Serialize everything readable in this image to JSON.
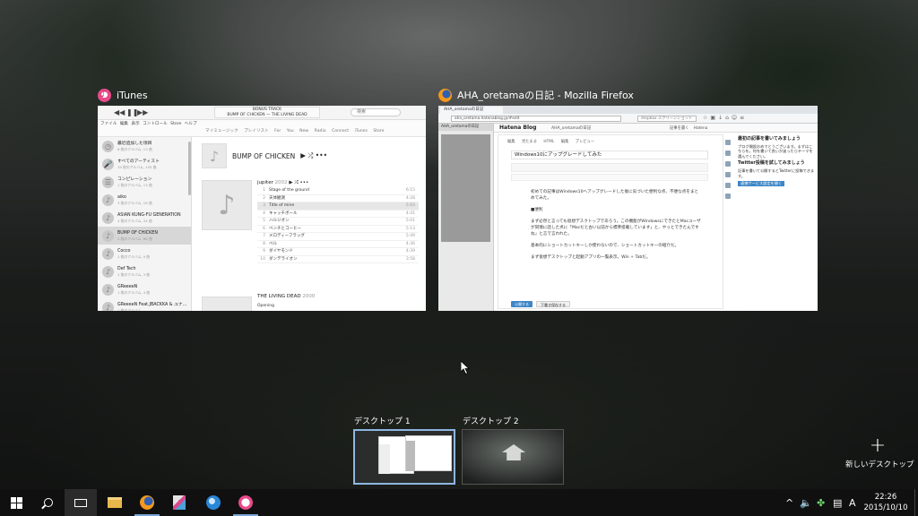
{
  "windows": {
    "itunes": {
      "title": "iTunes",
      "lcd_line1": "BONUS TRACK",
      "lcd_line2": "BUMP OF CHICKEN — THE LIVING DEAD",
      "search_placeholder": "検索",
      "menu": "ファイル  編集  表示  コントロール  Store  ヘルプ",
      "tabs": "マイミュージック  プレイリスト  For You  New  Radio  Connect  iTunes Store",
      "artists": [
        {
          "name": "最近追加した項目",
          "sub": "6 枚のアルバム, 13 曲",
          "icon": "clock-icon",
          "glyph": "◷"
        },
        {
          "name": "すべてのアーティスト",
          "sub": "19 枚のアルバム, 155 曲",
          "icon": "mic-icon",
          "glyph": "🎤"
        },
        {
          "name": "コンピレーション",
          "sub": "1 枚のアルバム, 13 曲",
          "icon": "compilation-icon",
          "glyph": "☰"
        },
        {
          "name": "aiko",
          "sub": "3 枚のアルバム, 16 曲",
          "icon": "music-note-icon",
          "glyph": "♪"
        },
        {
          "name": "ASIAN KUNG-FU GENERATION",
          "sub": "4 枚のアルバム, 34 曲",
          "icon": "music-note-icon",
          "glyph": "♪"
        },
        {
          "name": "BUMP OF CHICKEN",
          "sub": "5 枚のアルバム, 68 曲",
          "icon": "music-note-icon",
          "glyph": "♪"
        },
        {
          "name": "Cocco",
          "sub": "1 枚のアルバム, 9 曲",
          "icon": "music-note-icon",
          "glyph": "♪"
        },
        {
          "name": "Def Tech",
          "sub": "1 枚のアルバム, 3 曲",
          "icon": "music-note-icon",
          "glyph": "♪"
        },
        {
          "name": "GReeeeN",
          "sub": "1 枚のアルバム, 4 曲",
          "icon": "music-note-icon",
          "glyph": "♪"
        },
        {
          "name": "GReeeeN Feat.JBACKKA & ユナ…",
          "sub": "1 枚のアルバム",
          "icon": "music-note-icon",
          "glyph": "♪"
        }
      ],
      "band": "BUMP OF CHICKEN",
      "album_title": "jupiter",
      "album_year": "2002",
      "tracks": [
        {
          "no": "1",
          "title": "Stage of the ground",
          "dur": "6:15"
        },
        {
          "no": "2",
          "title": "天体観測",
          "dur": "4:28"
        },
        {
          "no": "3",
          "title": "Title of mine",
          "dur": "5:03"
        },
        {
          "no": "4",
          "title": "キャッチボール",
          "dur": "4:41"
        },
        {
          "no": "5",
          "title": "ハルジオン",
          "dur": "5:01"
        },
        {
          "no": "6",
          "title": "ベンチとコーヒー",
          "dur": "5:13"
        },
        {
          "no": "7",
          "title": "メロディーフラッグ",
          "dur": "5:49"
        },
        {
          "no": "8",
          "title": "ベル",
          "dur": "4:36"
        },
        {
          "no": "9",
          "title": "ダイヤモンド",
          "dur": "4:39"
        },
        {
          "no": "10",
          "title": "ダンデライオン",
          "dur": "3:58"
        }
      ],
      "album2_title": "THE LIVING DEAD",
      "album2_year": "2000",
      "album2_track": "Opening"
    },
    "firefox": {
      "title": "AHA_oretamaの日記 - Mozilla Firefox",
      "tab": "AHA_oretamaの日記",
      "url": "aha_oretama.hatenablog.jp/#edit",
      "search": "dropbox スクリーンショット",
      "side_header": "AHA_oretamaの日記",
      "blog_logo": "Hatena Blog",
      "blog_name": "AHA_oretamaの日記",
      "blog_right": "記事を書く  Hatena",
      "editor_tabs": "編集 見たまま  HTML 編集  プレビュー",
      "post_title": "Windows10にアップグレードしてみた",
      "paragraphs": [
        "初めての記事はWindows10へアップグレードした後に気づいた便利な点、不便な点をまとめてみた。",
        "■便利",
        "まず必然と言っても仮想デスクトップであろう。この機能がWindowsにできたとMacユーザが同情に話した点に「Macだと古い以前から標準搭載しています」と、やっとできたんですね」と言で言われた。",
        "基本的にショートカットキーしか使わないので、ショートカットキーの紹介だ。",
        "まず仮想デスクトップと起動アプリの一覧表示。Win + Tabだ。"
      ],
      "save_btn": "公開する",
      "draft_btn": "下書き保存する",
      "panel_h1": "最初の記事を書いてみましょう",
      "panel_p1": "ブログ開設おめでとうございます。まずはこちらを。何を書いて良いか迷ったらテーマを選んでください。",
      "panel_h2": "Twitter投稿を試してみましょう",
      "panel_p2": "記事を書いて公開するとTwitterに投稿できます。",
      "panel_btn": "連携サービス設定を開く"
    }
  },
  "desktops": [
    {
      "label": "デスクトップ 1"
    },
    {
      "label": "デスクトップ 2"
    }
  ],
  "new_desktop_label": "新しいデスクトップ",
  "taskbar": {
    "time": "22:26",
    "date": "2015/10/10",
    "ime": "A",
    "apps": [
      "start-button",
      "search-button",
      "task-view-button",
      "file-explorer",
      "firefox",
      "app-pinned",
      "network-app",
      "itunes"
    ]
  },
  "colors": {
    "accent": "#7aa7d6",
    "taskbar": "#101010"
  }
}
